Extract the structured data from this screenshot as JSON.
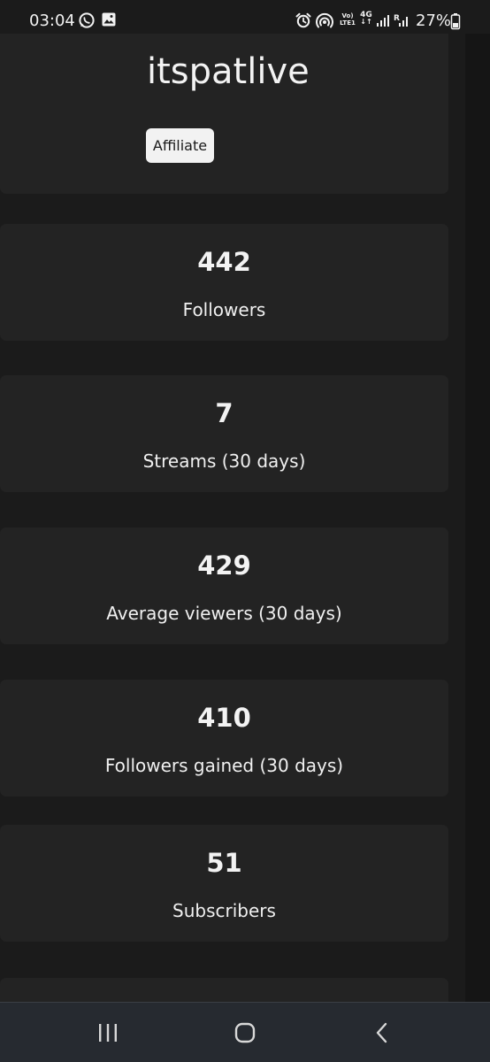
{
  "status_bar": {
    "time": "03:04",
    "battery": "27%",
    "volte_top": "Vo)",
    "volte_bottom": "LTE1",
    "net_type": "4G",
    "roaming": "R",
    "icons": [
      "whatsapp-icon",
      "gallery-icon",
      "alarm-icon",
      "hotspot-icon",
      "volte-icon",
      "signal-icon",
      "roaming-signal-icon",
      "battery-icon"
    ]
  },
  "profile": {
    "channel_name": "itspatlive",
    "badge": "Affiliate"
  },
  "stats": [
    {
      "value": "442",
      "label": "Followers"
    },
    {
      "value": "7",
      "label": "Streams (30 days)"
    },
    {
      "value": "429",
      "label": "Average viewers (30 days)"
    },
    {
      "value": "410",
      "label": "Followers gained (30 days)"
    },
    {
      "value": "51",
      "label": "Subscribers"
    }
  ],
  "nav_bar": {
    "buttons": [
      "recent-apps-icon",
      "home-icon",
      "back-icon"
    ]
  },
  "colors": {
    "background": "#1b1b1b",
    "card": "#232323",
    "text": "#f0f0f0",
    "badge_background": "#f2f2f2",
    "nav_background": "#262a30"
  }
}
